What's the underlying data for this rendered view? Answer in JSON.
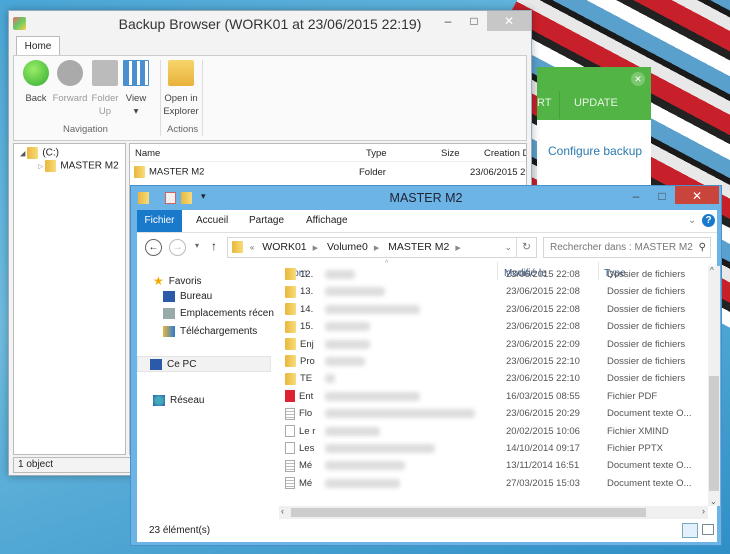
{
  "backup_browser": {
    "title": "Backup Browser (WORK01 at 23/06/2015 22:19)",
    "tab": "Home",
    "buttons": {
      "back": "Back",
      "forward": "Forward",
      "folder_up_1": "Folder",
      "folder_up_2": "Up",
      "view": "View",
      "view_arrow": "▾",
      "open_1": "Open in",
      "open_2": "Explorer"
    },
    "groups": {
      "navigation": "Navigation",
      "actions": "Actions"
    },
    "tree": {
      "root": "(C:)",
      "child": "MASTER M2"
    },
    "columns": {
      "name": "Name",
      "type": "Type",
      "size": "Size",
      "created": "Creation Da"
    },
    "rows": [
      {
        "name": "MASTER M2",
        "type": "Folder",
        "size": "",
        "created": "23/06/2015 22"
      }
    ],
    "status": "1 object"
  },
  "panel": {
    "tab1": "RT",
    "tab2": "UPDATE",
    "link": "Configure backup",
    "close": "✕"
  },
  "explorer": {
    "title": "MASTER M2",
    "tabs": [
      "Fichier",
      "Accueil",
      "Partage",
      "Affichage"
    ],
    "breadcrumb": {
      "prefix": "«",
      "parts": [
        "WORK01",
        "Volume0",
        "MASTER M2"
      ]
    },
    "search_placeholder": "Rechercher dans : MASTER M2",
    "nav": {
      "favoris": "Favoris",
      "bureau": "Bureau",
      "recent": "Emplacements récen",
      "downloads": "Téléchargements",
      "pc": "Ce PC",
      "network": "Réseau"
    },
    "columns": {
      "name": "Nom",
      "modified": "Modifié le",
      "type": "Type"
    },
    "rows": [
      {
        "name": "12.",
        "date": "23/06/2015 22:08",
        "type": "Dossier de fichiers",
        "icon": "folder"
      },
      {
        "name": "13.",
        "date": "23/06/2015 22:08",
        "type": "Dossier de fichiers",
        "icon": "folder"
      },
      {
        "name": "14.",
        "date": "23/06/2015 22:08",
        "type": "Dossier de fichiers",
        "icon": "folder"
      },
      {
        "name": "15.",
        "date": "23/06/2015 22:08",
        "type": "Dossier de fichiers",
        "icon": "folder"
      },
      {
        "name": "Enj",
        "date": "23/06/2015 22:09",
        "type": "Dossier de fichiers",
        "icon": "folder"
      },
      {
        "name": "Pro",
        "date": "23/06/2015 22:10",
        "type": "Dossier de fichiers",
        "icon": "folder"
      },
      {
        "name": "TE",
        "date": "23/06/2015 22:10",
        "type": "Dossier de fichiers",
        "icon": "folder"
      },
      {
        "name": "Ent",
        "date": "16/03/2015 08:55",
        "type": "Fichier PDF",
        "icon": "pdf"
      },
      {
        "name": "Flo",
        "date": "23/06/2015 20:29",
        "type": "Document texte O...",
        "icon": "doc"
      },
      {
        "name": "Le r",
        "date": "20/02/2015 10:06",
        "type": "Fichier XMIND",
        "icon": "file"
      },
      {
        "name": "Les",
        "date": "14/10/2014 09:17",
        "type": "Fichier PPTX",
        "icon": "file"
      },
      {
        "name": "Mé",
        "date": "13/11/2014 16:51",
        "type": "Document texte O...",
        "icon": "doc"
      },
      {
        "name": "Mé",
        "date": "27/03/2015 15:03",
        "type": "Document texte O...",
        "icon": "doc"
      }
    ],
    "status": "23 élément(s)"
  }
}
